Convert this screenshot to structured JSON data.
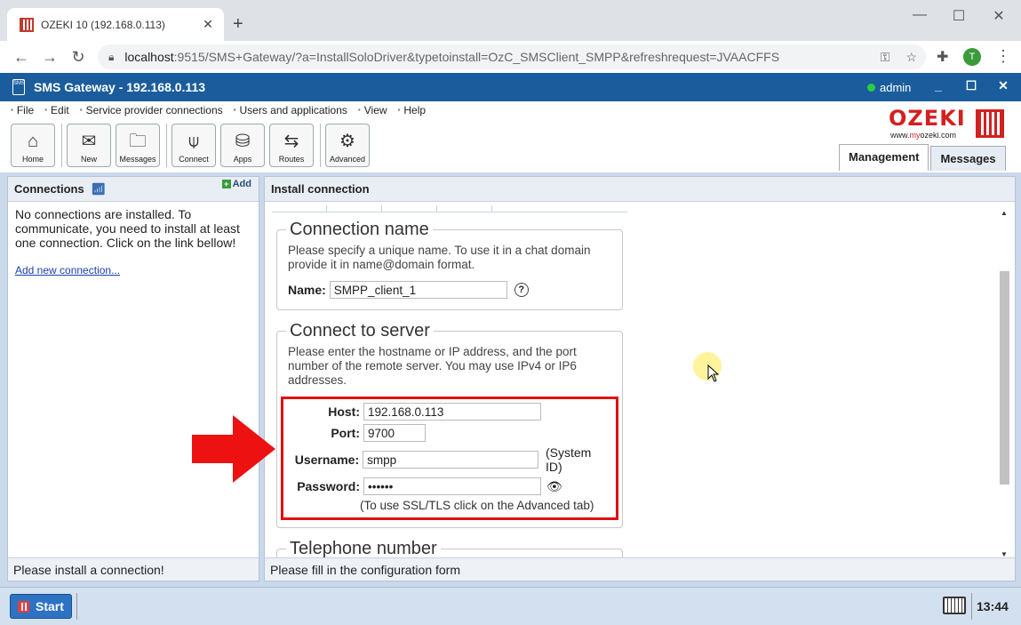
{
  "browser": {
    "tab_title": "OZEKI 10 (192.168.0.113)",
    "url_host": "localhost",
    "url_rest": ":9515/SMS+Gateway/?a=InstallSoloDriver&typetoinstall=OzC_SMSClient_SMPP&refreshrequest=JVAACFFS",
    "profile_initial": "T"
  },
  "app": {
    "title": "SMS Gateway - 192.168.0.113",
    "user": "admin",
    "menus": [
      "File",
      "Edit",
      "Service provider connections",
      "Users and applications",
      "View",
      "Help"
    ],
    "tools": [
      {
        "label": "Home",
        "icon": "home-icon"
      },
      {
        "label": "New",
        "icon": "new-icon"
      },
      {
        "label": "Messages",
        "icon": "folder-icon"
      },
      {
        "label": "Connect",
        "icon": "antenna-icon"
      },
      {
        "label": "Apps",
        "icon": "database-icon"
      },
      {
        "label": "Routes",
        "icon": "signpost-icon"
      },
      {
        "label": "Advanced",
        "icon": "gear-icon"
      }
    ],
    "logo": {
      "word": "OZEKI",
      "site_pre": "www.",
      "site_brand": "my",
      "site_post": "ozeki.com"
    },
    "view_tabs": [
      "Management",
      "Messages"
    ]
  },
  "left_pane": {
    "title": "Connections",
    "add_label": "Add",
    "message": "No connections are installed. To communicate, you need to install at least one connection. Click on the link bellow!",
    "link": "Add new connection...",
    "footer": "Please install a connection!"
  },
  "right_pane": {
    "title": "Install connection",
    "footer": "Please fill in the configuration form",
    "connection_name": {
      "legend": "Connection name",
      "help": "Please specify a unique name. To use it in a chat domain provide it in name@domain format.",
      "name_label": "Name:",
      "name_value": "SMPP_client_1",
      "help_icon": "?"
    },
    "connect_to_server": {
      "legend": "Connect to server",
      "help": "Please enter the hostname or IP address, and the port number of the remote server. You may use IPv4 or IP6 addresses.",
      "host_label": "Host:",
      "host_value": "192.168.0.113",
      "port_label": "Port:",
      "port_value": "9700",
      "username_label": "Username:",
      "username_value": "smpp",
      "username_note": "(System ID)",
      "password_label": "Password:",
      "password_value": "••••••",
      "ssl_note": "(To use SSL/TLS click on the Advanced tab)"
    },
    "telephone_number": {
      "legend": "Telephone number"
    }
  },
  "taskbar": {
    "start_label": "Start",
    "clock": "13:44"
  },
  "colors": {
    "app_bar": "#1b5d9c",
    "brand_red": "#d32020",
    "highlight_red": "#e01010"
  }
}
